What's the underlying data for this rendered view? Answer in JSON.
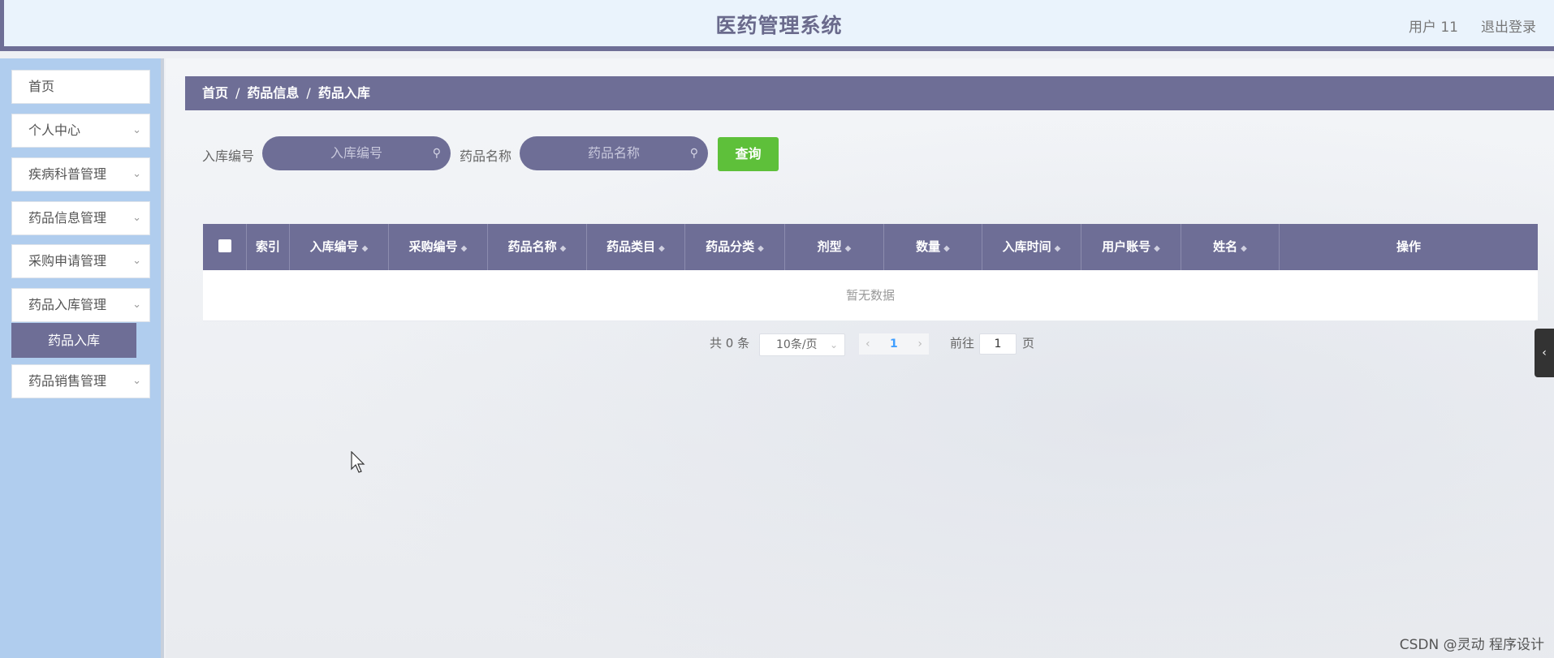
{
  "header": {
    "title": "医药管理系统",
    "user_label": "用户 11",
    "logout_label": "退出登录"
  },
  "sidebar": {
    "items": [
      {
        "label": "首页",
        "has_chevron": false
      },
      {
        "label": "个人中心",
        "has_chevron": true
      },
      {
        "label": "疾病科普管理",
        "has_chevron": true
      },
      {
        "label": "药品信息管理",
        "has_chevron": true
      },
      {
        "label": "采购申请管理",
        "has_chevron": true
      },
      {
        "label": "药品入库管理",
        "has_chevron": true
      },
      {
        "label": "药品销售管理",
        "has_chevron": true
      }
    ],
    "active_subitem": "药品入库"
  },
  "breadcrumb": {
    "items": [
      "首页",
      "药品信息",
      "药品入库"
    ],
    "separator": "/"
  },
  "search": {
    "field1_label": "入库编号",
    "field1_placeholder": "入库编号",
    "field2_label": "药品名称",
    "field2_placeholder": "药品名称",
    "query_label": "查询",
    "query_color": "#5ec03a"
  },
  "table": {
    "columns": [
      "",
      "索引",
      "入库编号",
      "采购编号",
      "药品名称",
      "药品类目",
      "药品分类",
      "剂型",
      "数量",
      "入库时间",
      "用户账号",
      "姓名",
      "操作"
    ],
    "sortable": [
      false,
      false,
      true,
      true,
      true,
      true,
      true,
      true,
      true,
      true,
      true,
      true,
      false
    ],
    "empty_text": "暂无数据"
  },
  "pagination": {
    "total_text": "共 0 条",
    "page_size": "10条/页",
    "current_page": "1",
    "goto_label": "前往",
    "goto_value": "1",
    "page_suffix": "页"
  },
  "theme": {
    "primary": "#6e6e96",
    "sidebar_bg": "#b0cdee",
    "header_bg": "#eaf3fc"
  },
  "watermark": "CSDN @灵动 程序设计"
}
